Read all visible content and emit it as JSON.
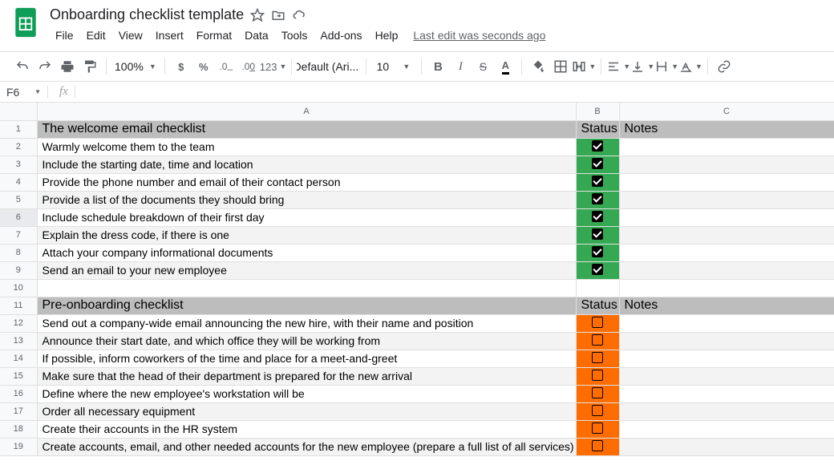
{
  "doc": {
    "title": "Onboarding checklist template",
    "last_edit": "Last edit was seconds ago"
  },
  "menu": {
    "file": "File",
    "edit": "Edit",
    "view": "View",
    "insert": "Insert",
    "format": "Format",
    "data": "Data",
    "tools": "Tools",
    "addons": "Add-ons",
    "help": "Help"
  },
  "toolbar": {
    "zoom": "100%",
    "font": "Default (Ari...",
    "fontsize": "10",
    "text_color_letter": "A"
  },
  "namebox": "F6",
  "formula": "",
  "columns": {
    "A": "A",
    "B": "B",
    "C": "C"
  },
  "rows": [
    {
      "n": 1,
      "type": "section",
      "a": "The welcome email checklist",
      "b": "Status",
      "c": "Notes"
    },
    {
      "n": 2,
      "type": "item",
      "a": "Warmly welcome them to the team",
      "status": "green",
      "checked": true,
      "alt": false
    },
    {
      "n": 3,
      "type": "item",
      "a": "Include the starting date, time and location",
      "status": "green",
      "checked": true,
      "alt": true
    },
    {
      "n": 4,
      "type": "item",
      "a": "Provide the phone number and email of their contact person",
      "status": "green",
      "checked": true,
      "alt": false
    },
    {
      "n": 5,
      "type": "item",
      "a": "Provide a list of the documents they should bring",
      "status": "green",
      "checked": true,
      "alt": true
    },
    {
      "n": 6,
      "type": "item",
      "a": "Include schedule breakdown of their first day",
      "status": "green",
      "checked": true,
      "alt": false,
      "selrow": true
    },
    {
      "n": 7,
      "type": "item",
      "a": "Explain the dress code, if there is one",
      "status": "green",
      "checked": true,
      "alt": true
    },
    {
      "n": 8,
      "type": "item",
      "a": "Attach your company informational documents",
      "status": "green",
      "checked": true,
      "alt": false
    },
    {
      "n": 9,
      "type": "item",
      "a": "Send an email to your new employee",
      "status": "green",
      "checked": true,
      "alt": true
    },
    {
      "n": 10,
      "type": "blank"
    },
    {
      "n": 11,
      "type": "section",
      "a": "Pre-onboarding checklist",
      "b": "Status",
      "c": "Notes"
    },
    {
      "n": 12,
      "type": "item",
      "a": "Send out a company-wide email announcing the new hire, with their name and position",
      "status": "orange",
      "checked": false,
      "alt": false
    },
    {
      "n": 13,
      "type": "item",
      "a": "Announce their start date, and which office they will be working from",
      "status": "orange",
      "checked": false,
      "alt": true
    },
    {
      "n": 14,
      "type": "item",
      "a": "If possible, inform coworkers of the time and place for a meet-and-greet",
      "status": "orange",
      "checked": false,
      "alt": false
    },
    {
      "n": 15,
      "type": "item",
      "a": "Make sure that the head of their department is prepared for the new arrival",
      "status": "orange",
      "checked": false,
      "alt": true
    },
    {
      "n": 16,
      "type": "item",
      "a": "Define where the new employee's workstation will be",
      "status": "orange",
      "checked": false,
      "alt": false
    },
    {
      "n": 17,
      "type": "item",
      "a": "Order all necessary equipment",
      "status": "orange",
      "checked": false,
      "alt": true
    },
    {
      "n": 18,
      "type": "item",
      "a": "Create their accounts in the HR system",
      "status": "orange",
      "checked": false,
      "alt": false
    },
    {
      "n": 19,
      "type": "item",
      "a": "Create accounts, email, and other needed accounts for the new employee (prepare a full list of all services)",
      "status": "orange",
      "checked": false,
      "alt": true
    }
  ]
}
